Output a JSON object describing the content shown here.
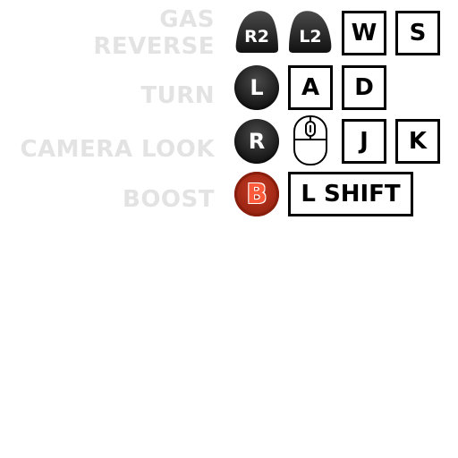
{
  "controls": {
    "gas_label": "GAS",
    "reverse_label": "REVERSE",
    "turn_label": "TURN",
    "camera_label": "CAMERA LOOK",
    "boost_label": "BOOST"
  },
  "gamepad": {
    "r2": "R2",
    "l2": "L2",
    "left_stick": "L",
    "right_stick": "R",
    "b_button": "B"
  },
  "keyboard": {
    "gas_key": "W",
    "reverse_key": "S",
    "turn_left_key": "A",
    "turn_right_key": "D",
    "camera_left_key": "J",
    "camera_right_key": "K",
    "boost_key": "L SHIFT"
  },
  "icons": {
    "mouse": "mouse-icon"
  },
  "colors": {
    "label": "#e3e3e3",
    "button_dark": "#1e1e1e",
    "button_b": "#a02814",
    "key_border": "#000000"
  }
}
